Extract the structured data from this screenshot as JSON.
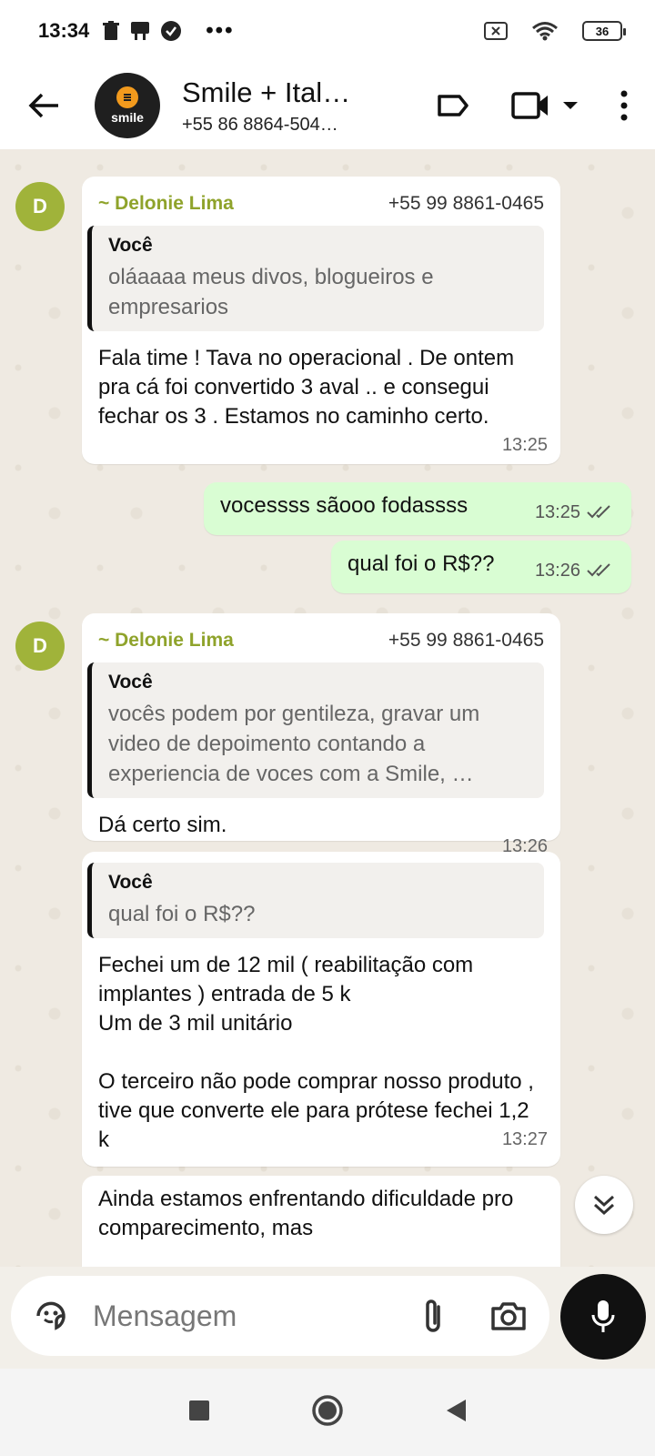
{
  "status_bar": {
    "time": "13:34",
    "battery": "36",
    "more": "•••"
  },
  "header": {
    "title": "Smile + Ital…",
    "subtitle": "+55 86 8864-504…",
    "avatar_logo_text": "smile"
  },
  "messages": [
    {
      "avatar_letter": "D",
      "sender": "~ Delonie Lima",
      "phone": "+55 99 8861-0465",
      "quote_author": "Você",
      "quote_text": "oláaaaa meus divos, blogueiros e empresarios",
      "text": "Fala time ! Tava no operacional . De ontem pra cá foi convertido 3 aval .. e consegui fechar os 3 . Estamos no caminho certo.",
      "time": "13:25"
    },
    {
      "text": "vocessss sãooo fodassss",
      "time": "13:25"
    },
    {
      "text": "qual foi o R$??",
      "time": "13:26"
    },
    {
      "avatar_letter": "D",
      "sender": "~ Delonie Lima",
      "phone": "+55 99 8861-0465",
      "quote_author": "Você",
      "quote_text": "vocês podem por gentileza, gravar um video de depoimento contando a experiencia de voces com a Smile, …",
      "text": "Dá certo sim.",
      "time": "13:26"
    },
    {
      "quote_author": "Você",
      "quote_text": "qual foi o R$??",
      "text": "Fechei um de 12 mil ( reabilitação com implantes ) entrada de 5 k\nUm de 3 mil unitário\n\nO terceiro não pode comprar nosso produto , tive que converte ele para prótese fechei 1,2 k",
      "time": "13:27"
    },
    {
      "text": "Ainda estamos enfrentando dificuldade pro comparecimento, mas"
    }
  ],
  "input": {
    "placeholder": "Mensagem"
  },
  "colors": {
    "sender_name": "#8fa32b",
    "avatar_bg": "#a0b33a",
    "outgoing_bubble": "#d9fdd3",
    "read_ticks": "#555555"
  }
}
